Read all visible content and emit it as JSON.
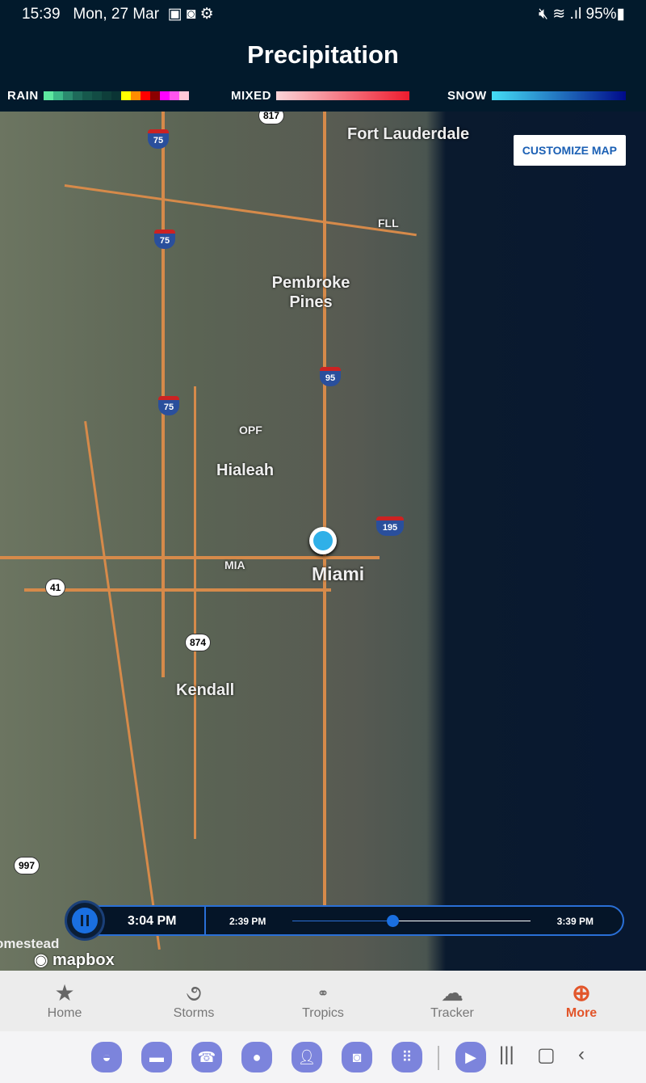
{
  "status": {
    "time": "15:39",
    "date": "Mon, 27 Mar",
    "battery": "95%",
    "left_icons": [
      "image-icon",
      "clock-icon",
      "gear-icon"
    ],
    "right_icons": [
      "mute-icon",
      "wifi-icon",
      "signal-icon",
      "battery-icon"
    ]
  },
  "header": {
    "title": "Precipitation"
  },
  "legend": {
    "rain": {
      "label": "RAIN",
      "colors": [
        "#5de8a0",
        "#3cb888",
        "#2a8a6e",
        "#1e6a5a",
        "#16584c",
        "#124c44",
        "#0e3e3a",
        "#0a3434",
        "#ffff00",
        "#ff8c00",
        "#ff0000",
        "#8b0000",
        "#ff00ff",
        "#ff55ee",
        "#ffc8d8"
      ]
    },
    "mixed": {
      "label": "MIXED",
      "from": "#fcd4d8",
      "to": "#ee1c2e"
    },
    "snow": {
      "label": "SNOW",
      "from": "#44ddf5",
      "to": "#000a8a"
    }
  },
  "map": {
    "customize_label": "CUSTOMIZE MAP",
    "cities": [
      "Fort Lauderdale",
      "Pembroke Pines",
      "Hialeah",
      "Miami",
      "Kendall",
      "omestead"
    ],
    "airports": [
      "FLL",
      "OPF",
      "MIA"
    ],
    "interstates": [
      "75",
      "75",
      "75",
      "95",
      "195"
    ],
    "routes": [
      "817",
      "41",
      "874",
      "997"
    ],
    "attribution": "mapbox"
  },
  "player": {
    "state": "playing",
    "current": "3:04 PM",
    "start": "2:39 PM",
    "end": "3:39 PM",
    "progress": 0.42
  },
  "tabs": [
    {
      "label": "Home",
      "icon": "star-icon"
    },
    {
      "label": "Storms",
      "icon": "hurricane-icon"
    },
    {
      "label": "Tropics",
      "icon": "binoculars-icon"
    },
    {
      "label": "Tracker",
      "icon": "storm-cloud-icon"
    },
    {
      "label": "More",
      "icon": "plus-circle-icon",
      "active": true
    }
  ],
  "accent": "#e2552a"
}
